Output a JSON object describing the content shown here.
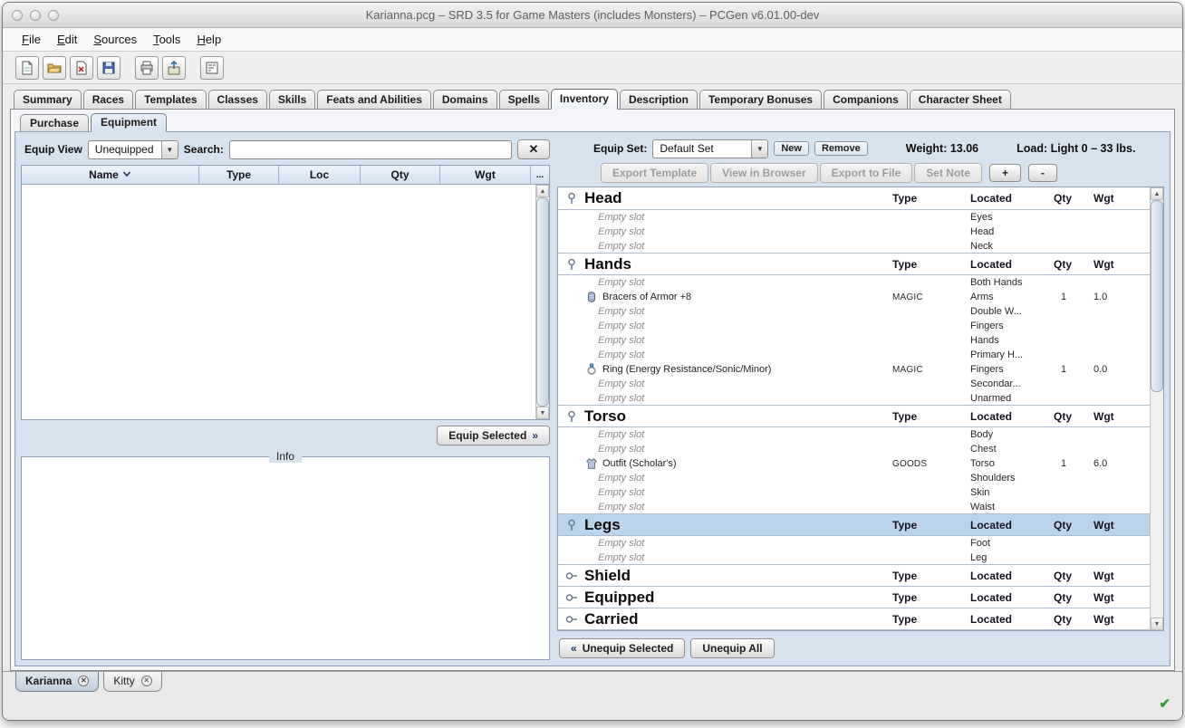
{
  "colors": {
    "selection_blue": "#bcd3ec",
    "status_ok_green": "#2f9e2f"
  },
  "icons": {
    "close_tab": "✕",
    "clear_search": "✕",
    "combo_arrow": "▼",
    "scroll_up": "▲",
    "scroll_down": "▼",
    "equip_chevron": "»",
    "unequip_chevron": "«",
    "status_ok": "✔"
  },
  "window": {
    "title": "Karianna.pcg – SRD 3.5 for Game Masters (includes Monsters) – PCGen v6.01.00-dev"
  },
  "menubar": {
    "items": [
      "File",
      "Edit",
      "Sources",
      "Tools",
      "Help"
    ]
  },
  "toolbar": {
    "groups": [
      [
        "new-file-icon",
        "open-file-icon",
        "close-file-icon",
        "save-file-icon"
      ],
      [
        "print-icon",
        "export-icon"
      ],
      [
        "preferences-icon"
      ]
    ]
  },
  "main_tabs": {
    "active": "Inventory",
    "items": [
      "Summary",
      "Races",
      "Templates",
      "Classes",
      "Skills",
      "Feats and Abilities",
      "Domains",
      "Spells",
      "Inventory",
      "Description",
      "Temporary Bonuses",
      "Companions",
      "Character Sheet"
    ]
  },
  "sub_tabs": {
    "active": "Equipment",
    "items": [
      "Purchase",
      "Equipment"
    ]
  },
  "left": {
    "equip_view_label": "Equip View",
    "equip_view_value": "Unequipped",
    "search_label": "Search:",
    "search_value": "",
    "table": {
      "columns": [
        "Name",
        "Type",
        "Loc",
        "Qty",
        "Wgt",
        "..."
      ],
      "sort_column": "Name",
      "rows": []
    },
    "equip_selected_label": "Equip Selected",
    "info_title": "Info"
  },
  "right": {
    "equip_set_label": "Equip Set:",
    "equip_set_value": "Default Set",
    "new_label": "New",
    "remove_label": "Remove",
    "weight_label": "Weight:",
    "weight_value": "13.06",
    "load_label": "Load:",
    "load_value": "Light 0 – 33 lbs.",
    "actions": [
      {
        "name": "export-template-button",
        "label": "Export Template",
        "enabled": false
      },
      {
        "name": "view-in-browser-button",
        "label": "View in Browser",
        "enabled": false
      },
      {
        "name": "export-to-file-button",
        "label": "Export to File",
        "enabled": false
      },
      {
        "name": "set-note-button",
        "label": "Set Note",
        "enabled": false
      },
      {
        "name": "add-equip-set-button",
        "label": "+",
        "enabled": true
      },
      {
        "name": "remove-equip-set-button",
        "label": "-",
        "enabled": true
      }
    ],
    "table": {
      "columns": [
        "Type",
        "Located",
        "Qty",
        "Wgt"
      ],
      "sections": [
        {
          "title": "Head",
          "expanded": true,
          "selected": false,
          "rows": [
            {
              "name": "Empty slot",
              "located": "Eyes",
              "empty": true
            },
            {
              "name": "Empty slot",
              "located": "Head",
              "empty": true
            },
            {
              "name": "Empty slot",
              "located": "Neck",
              "empty": true
            }
          ]
        },
        {
          "title": "Hands",
          "expanded": true,
          "selected": false,
          "rows": [
            {
              "name": "Empty slot",
              "located": "Both Hands",
              "empty": true
            },
            {
              "name": "Bracers of Armor +8",
              "icon": "bracers-icon",
              "type": "MAGIC",
              "located": "Arms",
              "qty": "1",
              "wgt": "1.0"
            },
            {
              "name": "Empty slot",
              "located": "Double W...",
              "empty": true
            },
            {
              "name": "Empty slot",
              "located": "Fingers",
              "empty": true
            },
            {
              "name": "Empty slot",
              "located": "Hands",
              "empty": true
            },
            {
              "name": "Empty slot",
              "located": "Primary H...",
              "empty": true
            },
            {
              "name": "Ring (Energy Resistance/Sonic/Minor)",
              "icon": "ring-icon",
              "type": "MAGIC",
              "located": "Fingers",
              "qty": "1",
              "wgt": "0.0"
            },
            {
              "name": "Empty slot",
              "located": "Secondar...",
              "empty": true
            },
            {
              "name": "Empty slot",
              "located": "Unarmed",
              "empty": true
            }
          ]
        },
        {
          "title": "Torso",
          "expanded": true,
          "selected": false,
          "rows": [
            {
              "name": "Empty slot",
              "located": "Body",
              "empty": true
            },
            {
              "name": "Empty slot",
              "located": "Chest",
              "empty": true
            },
            {
              "name": "Outfit (Scholar's)",
              "icon": "outfit-icon",
              "type": "GOODS",
              "located": "Torso",
              "qty": "1",
              "wgt": "6.0"
            },
            {
              "name": "Empty slot",
              "located": "Shoulders",
              "empty": true
            },
            {
              "name": "Empty slot",
              "located": "Skin",
              "empty": true
            },
            {
              "name": "Empty slot",
              "located": "Waist",
              "empty": true
            }
          ]
        },
        {
          "title": "Legs",
          "expanded": true,
          "selected": true,
          "rows": [
            {
              "name": "Empty slot",
              "located": "Foot",
              "empty": true
            },
            {
              "name": "Empty slot",
              "located": "Leg",
              "empty": true
            }
          ]
        },
        {
          "title": "Shield",
          "expanded": false,
          "selected": false,
          "rows": []
        },
        {
          "title": "Equipped",
          "expanded": false,
          "selected": false,
          "rows": []
        },
        {
          "title": "Carried",
          "expanded": false,
          "selected": false,
          "rows": []
        }
      ]
    },
    "unequip_selected_label": "Unequip Selected",
    "unequip_all_label": "Unequip All"
  },
  "bottom_tabs": {
    "items": [
      {
        "label": "Karianna",
        "active": true
      },
      {
        "label": "Kitty",
        "active": false
      }
    ]
  }
}
